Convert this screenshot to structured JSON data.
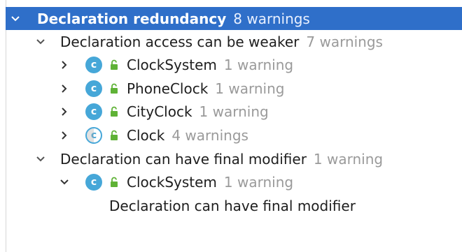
{
  "tree": {
    "root": {
      "label": "Declaration redundancy",
      "count": "8 warnings"
    },
    "groups": [
      {
        "label": "Declaration access can be weaker",
        "count": "7 warnings",
        "items": [
          {
            "icon": "class-icon",
            "icon_letter": "c",
            "name": "ClockSystem",
            "count": "1 warning"
          },
          {
            "icon": "class-icon",
            "icon_letter": "c",
            "name": "PhoneClock",
            "count": "1 warning"
          },
          {
            "icon": "class-icon",
            "icon_letter": "c",
            "name": "CityClock",
            "count": "1 warning"
          },
          {
            "icon": "abstract-class-icon",
            "icon_letter": "c",
            "name": "Clock",
            "count": "4 warnings"
          }
        ]
      },
      {
        "label": "Declaration can have final modifier",
        "count": "1 warning",
        "items": [
          {
            "icon": "class-icon",
            "icon_letter": "c",
            "name": "ClockSystem",
            "count": "1 warning"
          }
        ],
        "detail": "Declaration can have final modifier"
      }
    ]
  },
  "colors": {
    "selection": "#2f6fc9",
    "class_icon": "#46a7d8",
    "lock_icon": "#5fb236",
    "count_text": "#9a9a9a"
  }
}
